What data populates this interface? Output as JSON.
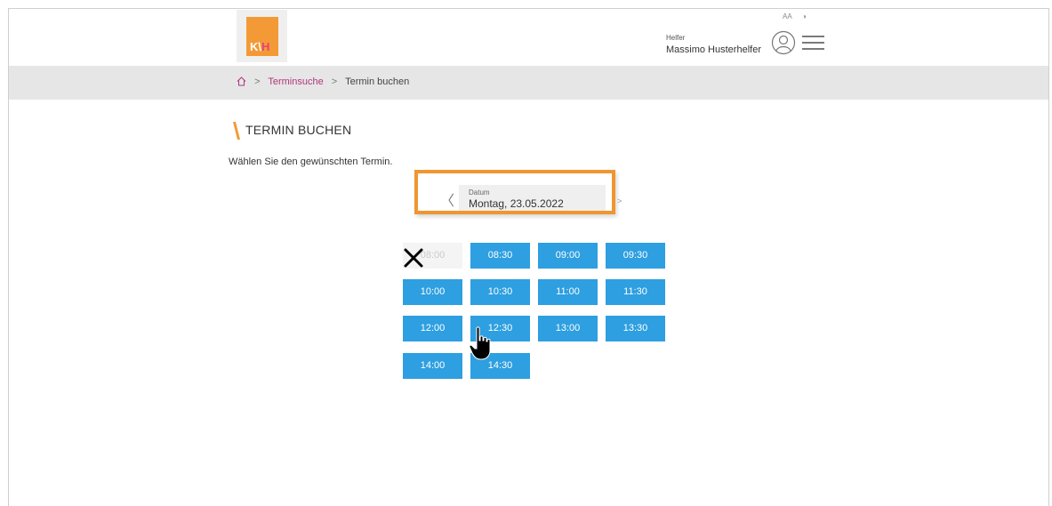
{
  "header": {
    "logo_text_main": "K\\",
    "logo_text_accent": "H",
    "tools": {
      "font_size": "AA",
      "contrast": "◑"
    },
    "user_role": "Helfer",
    "user_name": "Massimo Husterhelfer"
  },
  "breadcrumb": {
    "items": [
      "Terminsuche",
      "Termin buchen"
    ],
    "separator": ">"
  },
  "main": {
    "title": "TERMIN BUCHEN",
    "instruction": "Wählen Sie den gewünschten Termin.",
    "date_label": "Datum",
    "date_value": "Montag, 23.05.2022",
    "prev_glyph": "〈",
    "next_glyph": ">"
  },
  "slots": [
    {
      "time": "08:00",
      "available": false
    },
    {
      "time": "08:30",
      "available": true
    },
    {
      "time": "09:00",
      "available": true
    },
    {
      "time": "09:30",
      "available": true
    },
    {
      "time": "10:00",
      "available": true
    },
    {
      "time": "10:30",
      "available": true
    },
    {
      "time": "11:00",
      "available": true
    },
    {
      "time": "11:30",
      "available": true
    },
    {
      "time": "12:00",
      "available": true
    },
    {
      "time": "12:30",
      "available": true
    },
    {
      "time": "13:00",
      "available": true
    },
    {
      "time": "13:30",
      "available": true
    },
    {
      "time": "14:00",
      "available": true
    },
    {
      "time": "14:30",
      "available": true
    }
  ],
  "colors": {
    "accent_orange": "#f39a36",
    "slot_blue": "#2e9fe0",
    "link_magenta": "#b0367a",
    "breadcrumb_bg": "#e6e6e6"
  }
}
